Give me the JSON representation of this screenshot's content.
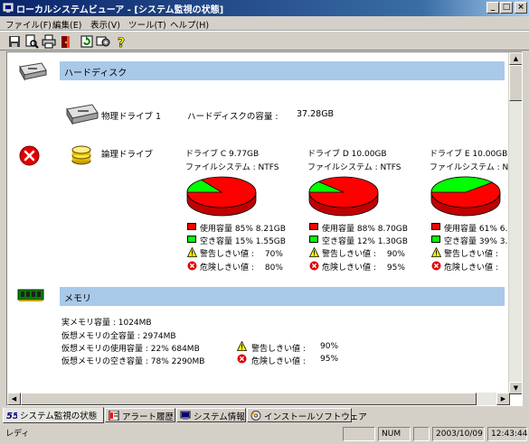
{
  "window": {
    "title": "ローカルシステムビューア - [システム監視の状態]",
    "minimize": "_",
    "maximize": "□",
    "close": "×"
  },
  "menu": [
    "ファイル(F)",
    "編集(E)",
    "表示(V)",
    "ツール(T)",
    "ヘルプ(H)"
  ],
  "toolbar_icons": [
    "save-icon",
    "preview-icon",
    "print-icon",
    "exit-icon",
    "refresh-icon",
    "settings-icon",
    "help-icon"
  ],
  "harddisk": {
    "section_label": "ハードディスク",
    "physical_label": "物理ドライブ 1",
    "capacity_label": "ハードディスクの容量 :",
    "capacity_value": "37.28GB",
    "logical_label": "論理ドライブ",
    "status": "error"
  },
  "drives": [
    {
      "title": "ドライブ C 9.77GB",
      "fs": "ファイルシステム : NTFS",
      "used_label": "使用容量",
      "used_pct": 85,
      "used_text": "85% 8.21GB",
      "free_label": "空き容量",
      "free_text": "15% 1.55GB",
      "warn_label": "警告しきい値 :",
      "warn_value": "70%",
      "danger_label": "危険しきい値 :",
      "danger_value": "80%"
    },
    {
      "title": "ドライブ D 10.00GB",
      "fs": "ファイルシステム : NTFS",
      "used_label": "使用容量",
      "used_pct": 88,
      "used_text": "88% 8.70GB",
      "free_label": "空き容量",
      "free_text": "12% 1.30GB",
      "warn_label": "警告しきい値 :",
      "warn_value": "90%",
      "danger_label": "危険しきい値 :",
      "danger_value": "95%"
    },
    {
      "title": "ドライブ E 10.00GB",
      "fs": "ファイルシステム : N",
      "used_label": "使用容量",
      "used_pct": 61,
      "used_text": "61% 6.",
      "free_label": "空き容量",
      "free_text": "39% 3.",
      "warn_label": "警告しきい値 :",
      "warn_value": "",
      "danger_label": "危険しきい値 :",
      "danger_value": ""
    }
  ],
  "memory": {
    "section_label": "メモリ",
    "real": "実メモリ容量 : 1024MB",
    "virtual_total": "仮想メモリの全容量 : 2974MB",
    "virtual_used": "仮想メモリの使用容量 : 22%  684MB",
    "virtual_free": "仮想メモリの空き容量 : 78% 2290MB",
    "warn_label": "警告しきい値 :",
    "warn_value": "90%",
    "danger_label": "危険しきい値 :",
    "danger_value": "95%"
  },
  "tabs": [
    "システム監視の状態",
    "アラート履歴",
    "システム情報",
    "インストールソフトウェア"
  ],
  "status": {
    "ready": "レディ",
    "num": "NUM",
    "date": "2003/10/09",
    "time": "12:43:44"
  },
  "colors": {
    "used": "#ff0000",
    "free": "#00ff00",
    "band": "#a9c9e9"
  }
}
